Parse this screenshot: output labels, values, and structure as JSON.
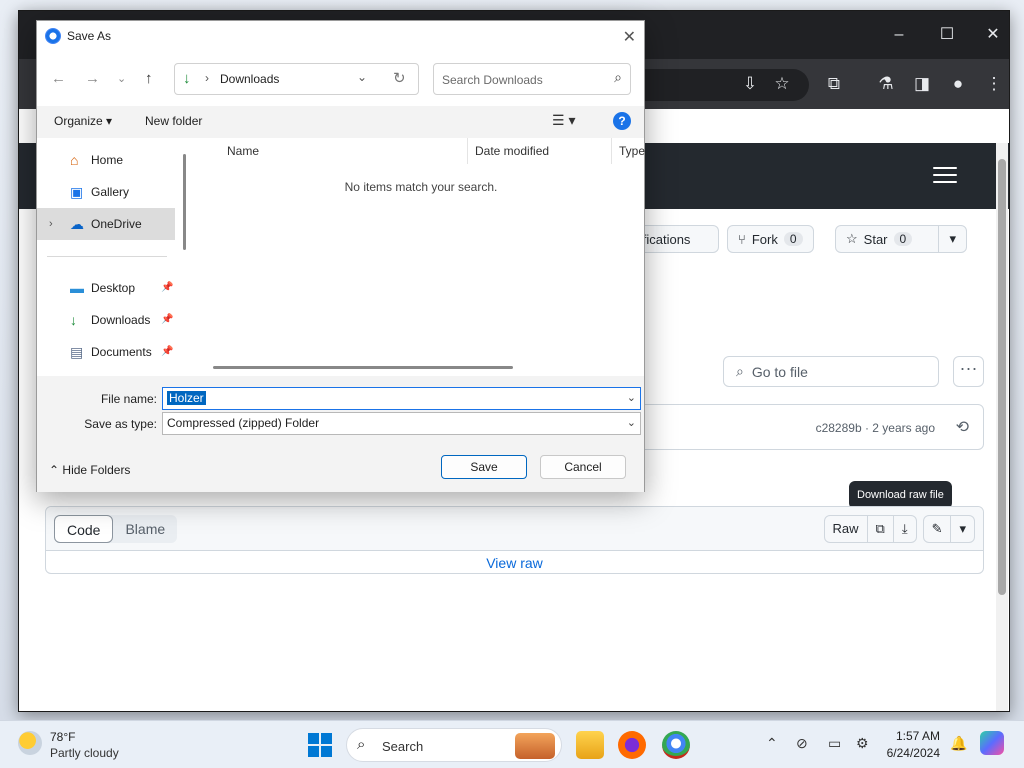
{
  "dialog": {
    "title": "Save As",
    "address": "Downloads",
    "search_placeholder": "Search Downloads",
    "organize_label": "Organize",
    "new_folder_label": "New folder",
    "nav_items": [
      {
        "label": "Home",
        "icon": "home-icon"
      },
      {
        "label": "Gallery",
        "icon": "gallery-icon"
      },
      {
        "label": "OneDrive",
        "icon": "onedrive-icon"
      },
      {
        "label": "Desktop",
        "icon": "desktop-icon"
      },
      {
        "label": "Downloads",
        "icon": "downloads-icon"
      },
      {
        "label": "Documents",
        "icon": "documents-icon"
      }
    ],
    "columns": [
      "Name",
      "Date modified",
      "Type"
    ],
    "empty_message": "No items match your search.",
    "file_name_label": "File name:",
    "file_name_value": "Holzer",
    "save_type_label": "Save as type:",
    "save_type_value": "Compressed (zipped) Folder",
    "hide_folders_label": "Hide Folders",
    "save_label": "Save",
    "cancel_label": "Cancel"
  },
  "github": {
    "notifications_label": "otifications",
    "fork_label": "Fork",
    "fork_count": "0",
    "star_label": "Star",
    "star_count": "0",
    "go_to_file": "Go to file",
    "commit_meta": "c28289b · 2 years ago",
    "code_tab": "Code",
    "blame_tab": "Blame",
    "raw_label": "Raw",
    "view_raw": "View raw",
    "tooltip": "Download raw file"
  },
  "taskbar": {
    "temperature": "78°F",
    "condition": "Partly cloudy",
    "search_label": "Search",
    "time": "1:57 AM",
    "date": "6/24/2024"
  },
  "colors": {
    "accent": "#0067c0",
    "github_header": "#24292f",
    "link": "#0969da"
  }
}
